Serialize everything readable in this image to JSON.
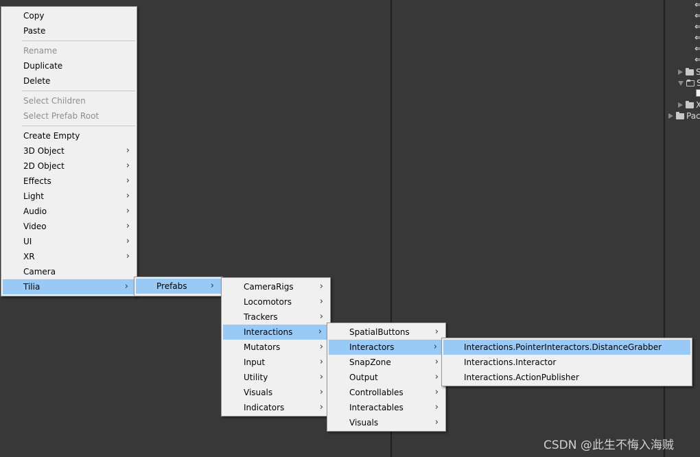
{
  "context_menu": {
    "items": [
      {
        "label": "Copy"
      },
      {
        "label": "Paste"
      },
      {
        "label": "Rename"
      },
      {
        "label": "Duplicate"
      },
      {
        "label": "Delete"
      },
      {
        "label": "Select Children"
      },
      {
        "label": "Select Prefab Root"
      },
      {
        "label": "Create Empty"
      },
      {
        "label": "3D Object"
      },
      {
        "label": "2D Object"
      },
      {
        "label": "Effects"
      },
      {
        "label": "Light"
      },
      {
        "label": "Audio"
      },
      {
        "label": "Video"
      },
      {
        "label": "UI"
      },
      {
        "label": "XR"
      },
      {
        "label": "Camera"
      },
      {
        "label": "Tilia"
      }
    ]
  },
  "tilia_submenu": {
    "items": [
      {
        "label": "Prefabs"
      }
    ]
  },
  "prefabs_submenu": {
    "items": [
      {
        "label": "CameraRigs"
      },
      {
        "label": "Locomotors"
      },
      {
        "label": "Trackers"
      },
      {
        "label": "Interactions"
      },
      {
        "label": "Mutators"
      },
      {
        "label": "Input"
      },
      {
        "label": "Utility"
      },
      {
        "label": "Visuals"
      },
      {
        "label": "Indicators"
      }
    ]
  },
  "interactions_submenu": {
    "items": [
      {
        "label": "SpatialButtons"
      },
      {
        "label": "Interactors"
      },
      {
        "label": "SnapZone"
      },
      {
        "label": "Output"
      },
      {
        "label": "Controllables"
      },
      {
        "label": "Interactables"
      },
      {
        "label": "Visuals"
      }
    ]
  },
  "interactors_submenu": {
    "items": [
      {
        "label": "Interactions.PointerInteractors.DistanceGrabber"
      },
      {
        "label": "Interactions.Interactor"
      },
      {
        "label": "Interactions.ActionPublisher"
      }
    ]
  },
  "hierarchy": {
    "arrow_glyph": "⇐",
    "rows": [
      {
        "label": "S"
      },
      {
        "label": "S"
      },
      {
        "label": "X"
      },
      {
        "label": "Pac"
      }
    ]
  },
  "chevron": "›",
  "watermark": "CSDN @此生不悔入海贼",
  "colors": {
    "menu_bg": "#f0f0f0",
    "highlight": "#99c9f5",
    "disabled_text": "#8d8d8d",
    "editor_bg": "#383838"
  }
}
